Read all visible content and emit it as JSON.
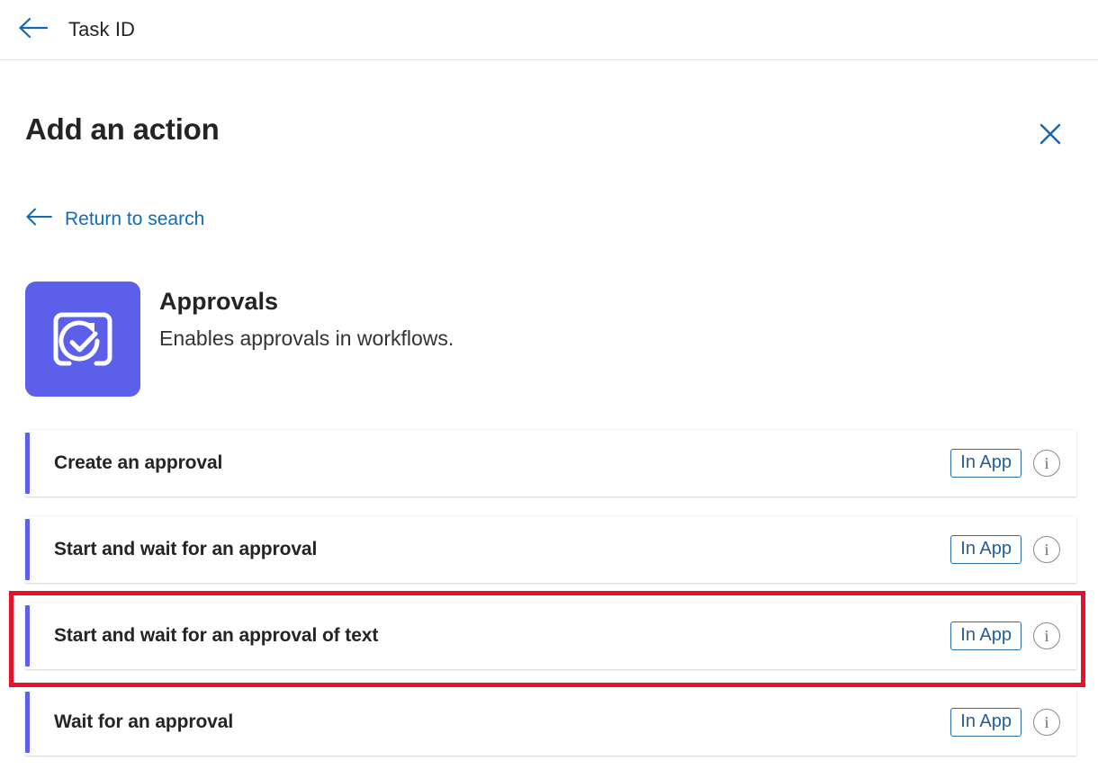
{
  "topbar": {
    "back_icon": "arrow-left-icon",
    "title": "Task ID"
  },
  "panel": {
    "title": "Add an action",
    "close_icon": "close-icon",
    "return_link": {
      "icon": "arrow-left-icon",
      "label": "Return to search"
    }
  },
  "connector": {
    "icon": "approvals-icon",
    "name": "Approvals",
    "description": "Enables approvals in workflows."
  },
  "actions": [
    {
      "label": "Create an approval",
      "badge": "In App",
      "info_icon": "info-icon"
    },
    {
      "label": "Start and wait for an approval",
      "badge": "In App",
      "info_icon": "info-icon"
    },
    {
      "label": "Start and wait for an approval of text",
      "badge": "In App",
      "info_icon": "info-icon"
    },
    {
      "label": "Wait for an approval",
      "badge": "In App",
      "info_icon": "info-icon"
    }
  ],
  "annotation": {
    "target_label": "Start and wait for an approval of text",
    "color": "#e8102a"
  },
  "colors": {
    "accent_purple": "#5b5fe9",
    "link_blue": "#0f6cbd",
    "badge_blue": "#1c5f9e",
    "text_dark": "#242424",
    "highlight_red": "#e8102a"
  }
}
